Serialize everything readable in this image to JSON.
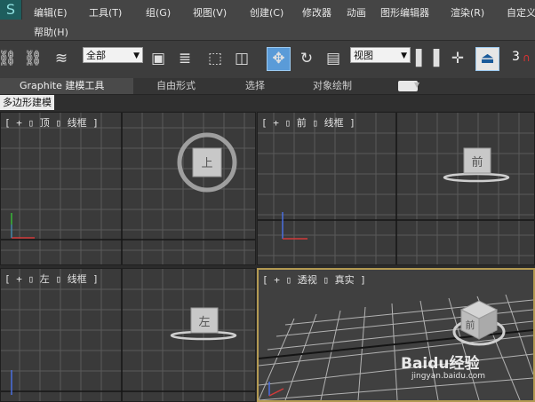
{
  "app": {
    "logo_glyph": "S"
  },
  "menu": {
    "items": [
      "编辑(E)",
      "工具(T)",
      "组(G)",
      "视图(V)",
      "创建(C)",
      "修改器",
      "动画",
      "图形编辑器",
      "渲染(R)",
      "自定义"
    ],
    "help": "帮助(H)"
  },
  "toolbar": {
    "selection_filter": "全部",
    "reference_coord": "视图",
    "snap_value": "3",
    "snap_suffix": "∩"
  },
  "ribbon": {
    "tabs": [
      "Graphite 建模工具",
      "自由形式",
      "选择",
      "对象绘制"
    ],
    "panel": "多边形建模"
  },
  "viewports": [
    {
      "id": "top",
      "label": "[ + ▯ 顶 ▯ 线框 ]",
      "cube_face": "上"
    },
    {
      "id": "front",
      "label": "[ + ▯ 前 ▯ 线框 ]",
      "cube_face": "前"
    },
    {
      "id": "left",
      "label": "[ + ▯ 左 ▯ 线框 ]",
      "cube_face": "左"
    },
    {
      "id": "perspective",
      "label": "[ + ▯ 透视 ▯ 真实 ]",
      "cube_face": "前"
    }
  ],
  "colors": {
    "active_viewport_border": "#b49a52",
    "axis_x": "#d23a3a",
    "axis_y": "#38b838",
    "axis_z": "#4a6ee0"
  },
  "watermark": {
    "brand": "Baidu经验",
    "url": "jingyan.baidu.com"
  }
}
